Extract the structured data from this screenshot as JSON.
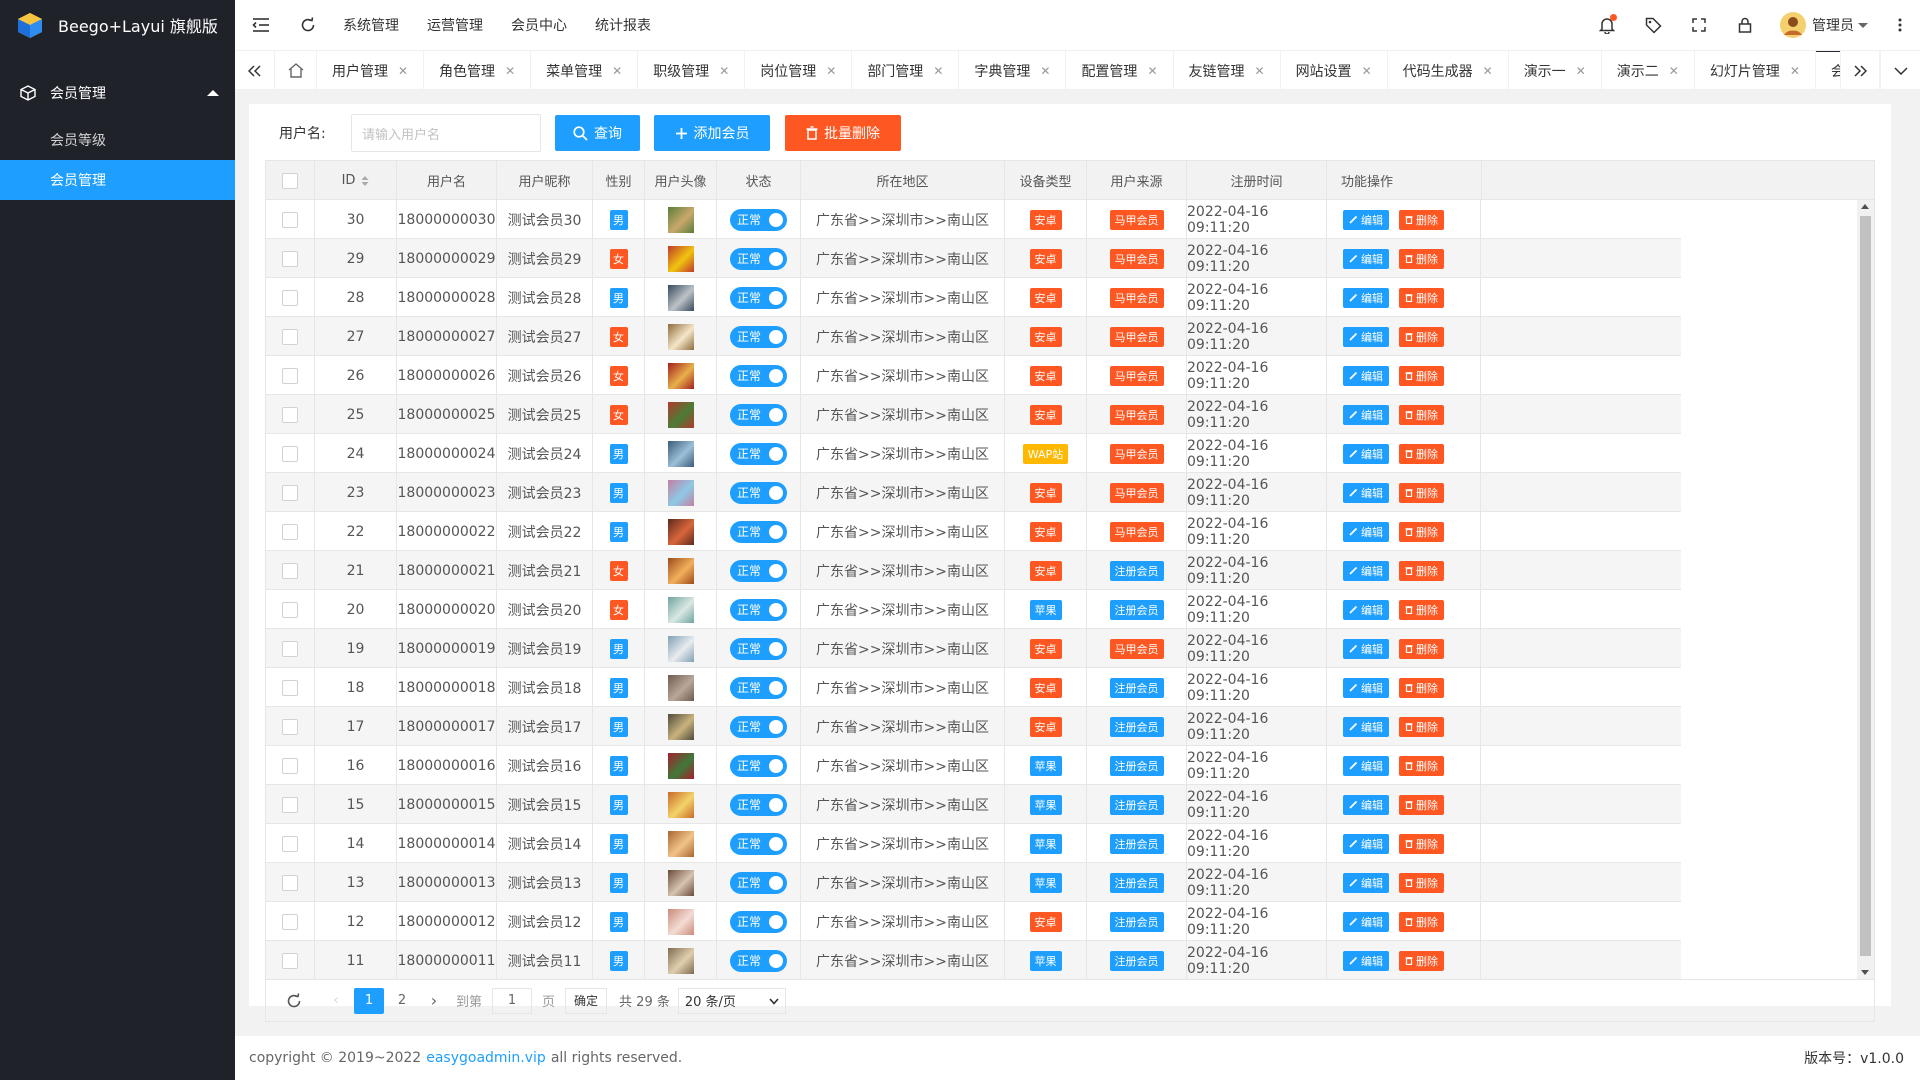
{
  "app": {
    "title": "Beego+Layui 旗舰版"
  },
  "sidebar": {
    "group_label": "会员管理",
    "items": [
      {
        "label": "会员等级",
        "active": false
      },
      {
        "label": "会员管理",
        "active": true
      }
    ]
  },
  "header": {
    "nav": [
      "系统管理",
      "运营管理",
      "会员中心",
      "统计报表"
    ],
    "active_nav": 2,
    "user": "管理员"
  },
  "tabs": {
    "items": [
      "用户管理",
      "角色管理",
      "菜单管理",
      "职级管理",
      "岗位管理",
      "部门管理",
      "字典管理",
      "配置管理",
      "友链管理",
      "网站设置",
      "代码生成器",
      "演示一",
      "演示二",
      "幻灯片管理",
      "会员管理"
    ],
    "active": 14
  },
  "search": {
    "label": "用户名:",
    "placeholder": "请输入用户名",
    "query_label": "查询",
    "add_label": "添加会员",
    "batch_delete_label": "批量删除"
  },
  "table": {
    "columns": [
      "ID",
      "用户名",
      "用户昵称",
      "性别",
      "用户头像",
      "状态",
      "所在地区",
      "设备类型",
      "用户来源",
      "注册时间",
      "功能操作"
    ],
    "status_label": "正常",
    "edit_label": "编辑",
    "delete_label": "删除",
    "rows": [
      {
        "id": "30",
        "username": "18000000030",
        "nickname": "测试会员30",
        "gender": "男",
        "region": "广东省>>深圳市>>南山区",
        "device": "安卓",
        "source": "马甲会员",
        "time": "2022-04-16 09:11:20"
      },
      {
        "id": "29",
        "username": "18000000029",
        "nickname": "测试会员29",
        "gender": "女",
        "region": "广东省>>深圳市>>南山区",
        "device": "安卓",
        "source": "马甲会员",
        "time": "2022-04-16 09:11:20"
      },
      {
        "id": "28",
        "username": "18000000028",
        "nickname": "测试会员28",
        "gender": "男",
        "region": "广东省>>深圳市>>南山区",
        "device": "安卓",
        "source": "马甲会员",
        "time": "2022-04-16 09:11:20"
      },
      {
        "id": "27",
        "username": "18000000027",
        "nickname": "测试会员27",
        "gender": "女",
        "region": "广东省>>深圳市>>南山区",
        "device": "安卓",
        "source": "马甲会员",
        "time": "2022-04-16 09:11:20"
      },
      {
        "id": "26",
        "username": "18000000026",
        "nickname": "测试会员26",
        "gender": "女",
        "region": "广东省>>深圳市>>南山区",
        "device": "安卓",
        "source": "马甲会员",
        "time": "2022-04-16 09:11:20"
      },
      {
        "id": "25",
        "username": "18000000025",
        "nickname": "测试会员25",
        "gender": "女",
        "region": "广东省>>深圳市>>南山区",
        "device": "安卓",
        "source": "马甲会员",
        "time": "2022-04-16 09:11:20"
      },
      {
        "id": "24",
        "username": "18000000024",
        "nickname": "测试会员24",
        "gender": "男",
        "region": "广东省>>深圳市>>南山区",
        "device": "WAP站",
        "source": "马甲会员",
        "time": "2022-04-16 09:11:20"
      },
      {
        "id": "23",
        "username": "18000000023",
        "nickname": "测试会员23",
        "gender": "男",
        "region": "广东省>>深圳市>>南山区",
        "device": "安卓",
        "source": "马甲会员",
        "time": "2022-04-16 09:11:20"
      },
      {
        "id": "22",
        "username": "18000000022",
        "nickname": "测试会员22",
        "gender": "男",
        "region": "广东省>>深圳市>>南山区",
        "device": "安卓",
        "source": "马甲会员",
        "time": "2022-04-16 09:11:20"
      },
      {
        "id": "21",
        "username": "18000000021",
        "nickname": "测试会员21",
        "gender": "女",
        "region": "广东省>>深圳市>>南山区",
        "device": "安卓",
        "source": "注册会员",
        "time": "2022-04-16 09:11:20"
      },
      {
        "id": "20",
        "username": "18000000020",
        "nickname": "测试会员20",
        "gender": "女",
        "region": "广东省>>深圳市>>南山区",
        "device": "苹果",
        "source": "注册会员",
        "time": "2022-04-16 09:11:20"
      },
      {
        "id": "19",
        "username": "18000000019",
        "nickname": "测试会员19",
        "gender": "男",
        "region": "广东省>>深圳市>>南山区",
        "device": "安卓",
        "source": "马甲会员",
        "time": "2022-04-16 09:11:20"
      },
      {
        "id": "18",
        "username": "18000000018",
        "nickname": "测试会员18",
        "gender": "男",
        "region": "广东省>>深圳市>>南山区",
        "device": "安卓",
        "source": "注册会员",
        "time": "2022-04-16 09:11:20"
      },
      {
        "id": "17",
        "username": "18000000017",
        "nickname": "测试会员17",
        "gender": "男",
        "region": "广东省>>深圳市>>南山区",
        "device": "安卓",
        "source": "注册会员",
        "time": "2022-04-16 09:11:20"
      },
      {
        "id": "16",
        "username": "18000000016",
        "nickname": "测试会员16",
        "gender": "男",
        "region": "广东省>>深圳市>>南山区",
        "device": "苹果",
        "source": "注册会员",
        "time": "2022-04-16 09:11:20"
      },
      {
        "id": "15",
        "username": "18000000015",
        "nickname": "测试会员15",
        "gender": "男",
        "region": "广东省>>深圳市>>南山区",
        "device": "苹果",
        "source": "注册会员",
        "time": "2022-04-16 09:11:20"
      },
      {
        "id": "14",
        "username": "18000000014",
        "nickname": "测试会员14",
        "gender": "男",
        "region": "广东省>>深圳市>>南山区",
        "device": "苹果",
        "source": "注册会员",
        "time": "2022-04-16 09:11:20"
      },
      {
        "id": "13",
        "username": "18000000013",
        "nickname": "测试会员13",
        "gender": "男",
        "region": "广东省>>深圳市>>南山区",
        "device": "苹果",
        "source": "注册会员",
        "time": "2022-04-16 09:11:20"
      },
      {
        "id": "12",
        "username": "18000000012",
        "nickname": "测试会员12",
        "gender": "男",
        "region": "广东省>>深圳市>>南山区",
        "device": "安卓",
        "source": "注册会员",
        "time": "2022-04-16 09:11:20"
      },
      {
        "id": "11",
        "username": "18000000011",
        "nickname": "测试会员11",
        "gender": "男",
        "region": "广东省>>深圳市>>南山区",
        "device": "苹果",
        "source": "注册会员",
        "time": "2022-04-16 09:11:20"
      }
    ]
  },
  "pager": {
    "pages": [
      "1",
      "2"
    ],
    "current": "1",
    "goto_label": "到第",
    "goto_value": "1",
    "page_unit": "页",
    "confirm_label": "确定",
    "total_label": "共 29 条",
    "per_page": "20 条/页"
  },
  "footer": {
    "copyright": "copyright © 2019~2022",
    "link": "easygoadmin.vip",
    "rights": "all rights reserved.",
    "version": "版本号：v1.0.0"
  },
  "colors": {
    "sidebar_bg": "#20222a",
    "primary": "#1e9fff",
    "danger": "#ff5722",
    "warm": "#ffb800"
  },
  "icons": {
    "logo": "cube-logo-icon",
    "menu_toggle": "menu-fold-icon",
    "refresh": "refresh-icon",
    "notice": "bell-icon",
    "theme": "tag-icon",
    "fullscreen": "fullscreen-icon",
    "lock": "lock-icon",
    "more": "more-vertical-icon"
  }
}
